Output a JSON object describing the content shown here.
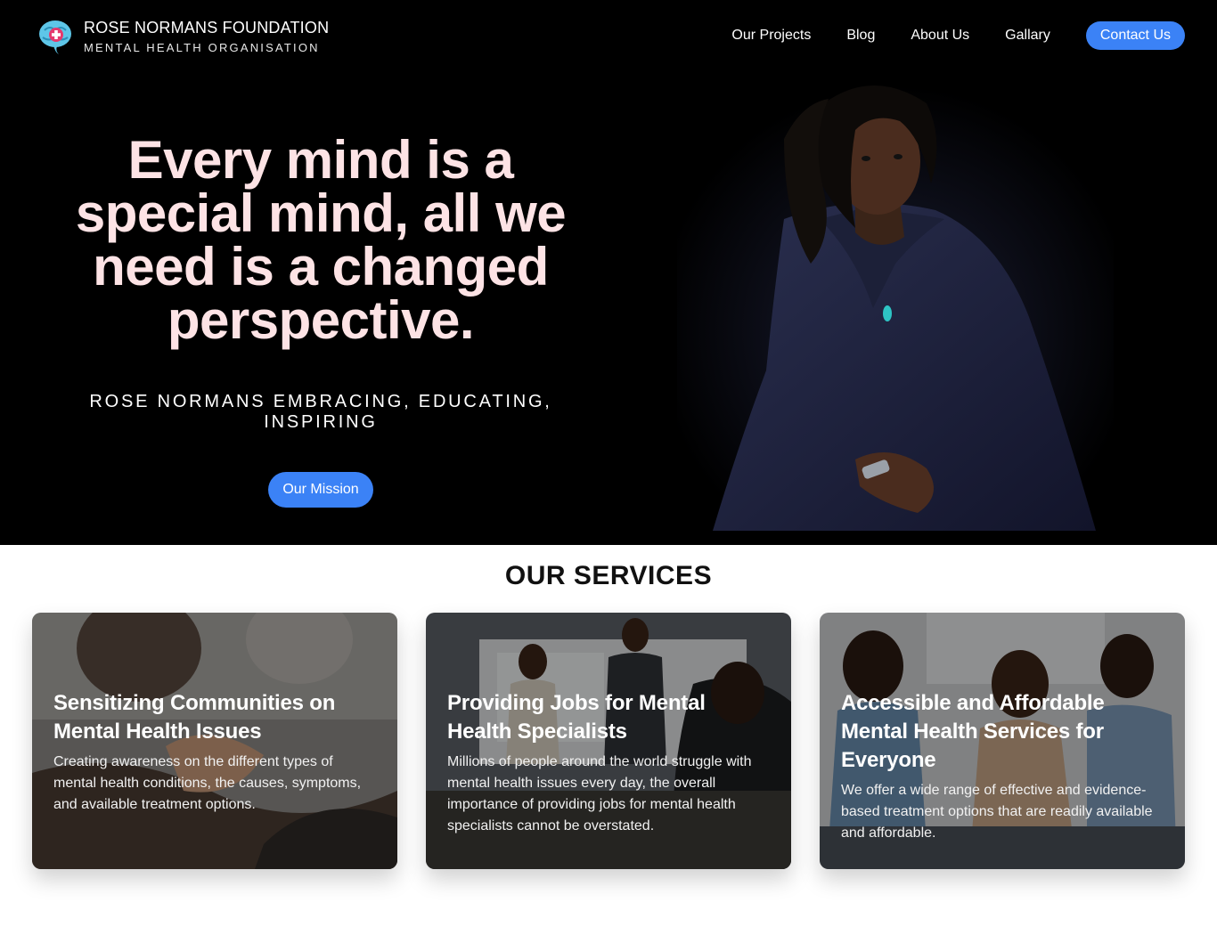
{
  "header": {
    "org_name": "ROSE NORMANS FOUNDATION",
    "org_tagline": "MENTAL HEALTH ORGANISATION",
    "logo_icon": "brain-medical-cross-icon"
  },
  "nav": {
    "items": [
      {
        "label": "Our Projects"
      },
      {
        "label": "Blog"
      },
      {
        "label": "About Us"
      },
      {
        "label": "Gallary"
      }
    ],
    "contact_label": "Contact Us"
  },
  "hero": {
    "headline": "Every mind is a special mind, all we need is a changed perspective.",
    "tagline": "ROSE NORMANS EMBRACING, EDUCATING, INSPIRING",
    "cta_label": "Our Mission"
  },
  "services": {
    "title": "OUR SERVICES",
    "cards": [
      {
        "title": "Sensitizing Communities on Mental Health Issues",
        "text": "Creating awareness on the different types of mental health conditions, the causes, symptoms, and available treatment options."
      },
      {
        "title": "Providing Jobs for Mental Health Specialists",
        "text": "Millions of people around the world struggle with mental health issues every day, the overall importance of providing jobs for mental health specialists cannot be overstated."
      },
      {
        "title": "Accessible and Affordable Mental Health Services for Everyone",
        "text": "We offer a wide range of effective and evidence-based treatment options that are readily available and affordable."
      }
    ]
  },
  "colors": {
    "accent": "#3b82f6",
    "hero_bg": "#000000",
    "headline": "#fde3e5"
  }
}
